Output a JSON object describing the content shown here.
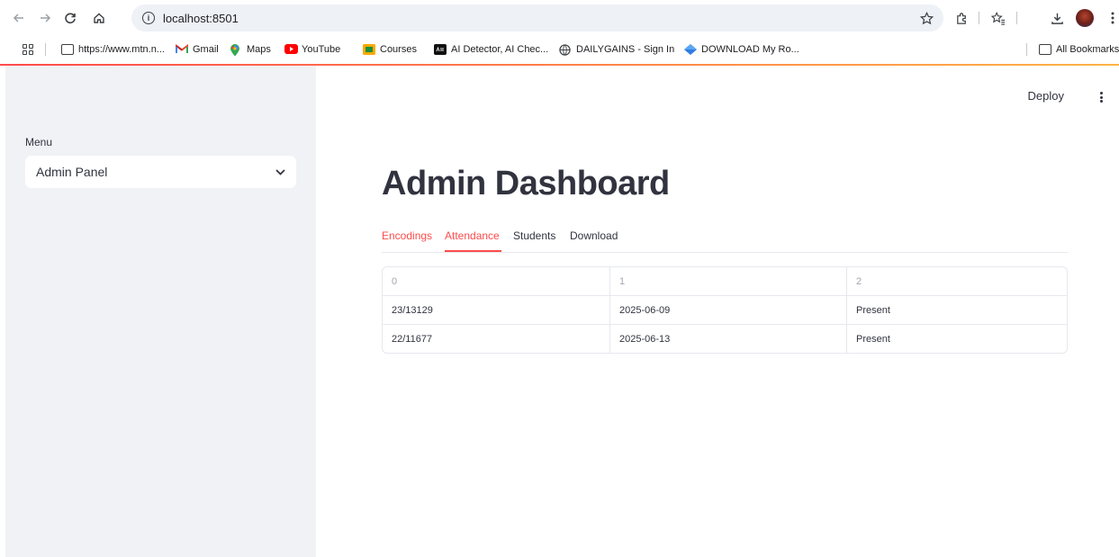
{
  "browser": {
    "url": "localhost:8501",
    "bookmarks": [
      {
        "label": "https://www.mtn.n..."
      },
      {
        "label": "Gmail"
      },
      {
        "label": "Maps"
      },
      {
        "label": "YouTube"
      },
      {
        "label": "Courses"
      },
      {
        "label": "AI Detector, AI Chec..."
      },
      {
        "label": "DAILYGAINS - Sign In"
      },
      {
        "label": "DOWNLOAD My Ro..."
      }
    ],
    "all_bookmarks": "All Bookmarks"
  },
  "sidebar": {
    "menu_label": "Menu",
    "select_value": "Admin Panel"
  },
  "header": {
    "deploy_label": "Deploy"
  },
  "main": {
    "title": "Admin Dashboard",
    "tabs": [
      {
        "label": "Encodings"
      },
      {
        "label": "Attendance"
      },
      {
        "label": "Students"
      },
      {
        "label": "Download"
      }
    ],
    "active_tab": "Attendance",
    "table": {
      "columns": [
        "0",
        "1",
        "2"
      ],
      "rows": [
        [
          "23/13129",
          "2025-06-09",
          "Present"
        ],
        [
          "22/11677",
          "2025-06-13",
          "Present"
        ]
      ]
    }
  },
  "colors": {
    "accent": "#ff4b4b",
    "sidebar_bg": "#f0f2f6",
    "text": "#31333f"
  }
}
